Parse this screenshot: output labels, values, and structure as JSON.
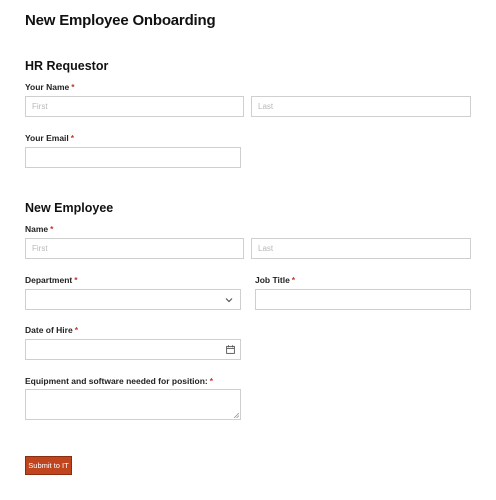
{
  "form": {
    "title": "New Employee Onboarding",
    "submit_label": "Submit to IT"
  },
  "hr_requestor": {
    "section_title": "HR Requestor",
    "your_name_label": "Your Name",
    "first_placeholder": "First",
    "last_placeholder": "Last",
    "your_email_label": "Your Email"
  },
  "new_employee": {
    "section_title": "New Employee",
    "name_label": "Name",
    "first_placeholder": "First",
    "last_placeholder": "Last",
    "department_label": "Department",
    "job_title_label": "Job Title",
    "date_of_hire_label": "Date of Hire",
    "equipment_label": "Equipment and software needed for position:"
  },
  "required_marker": "*",
  "colors": {
    "accent": "#c0451f",
    "required": "#c0392b",
    "border": "#cfcfcf"
  },
  "icons": {
    "department_dropdown": "chevron-down-icon",
    "date_picker": "calendar-icon",
    "textarea_resize": "resize-handle-icon"
  }
}
